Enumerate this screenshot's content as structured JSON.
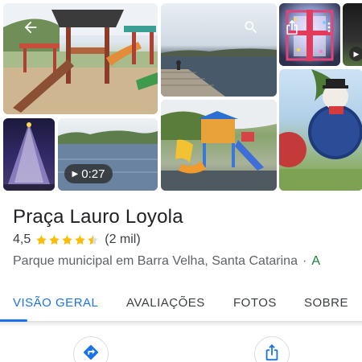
{
  "place": {
    "name": "Praça Lauro Loyola",
    "rating": "4,5",
    "rating_value": 4.5,
    "review_count": "(2 mil)",
    "category": "Parque municipal em Barra Velha, Santa Catarina",
    "separator": "·",
    "category_next": "A"
  },
  "gallery": {
    "video_duration": "0:27",
    "icons": [
      "back-arrow-icon",
      "search-icon",
      "share-icon",
      "more-vert-icon",
      "play-icon"
    ]
  },
  "tabs": [
    {
      "label": "VISÃO GERAL",
      "active": true
    },
    {
      "label": "AVALIAÇÕES",
      "active": false
    },
    {
      "label": "FOTOS",
      "active": false
    },
    {
      "label": "SOBRE",
      "active": false
    }
  ],
  "actions": [
    {
      "icon": "directions-icon"
    },
    {
      "icon": "share-icon"
    }
  ],
  "colors": {
    "accent": "#1a73e8",
    "star": "#fbbc04",
    "text_primary": "#202124",
    "text_secondary": "#5f6368",
    "link_green": "#188038"
  }
}
